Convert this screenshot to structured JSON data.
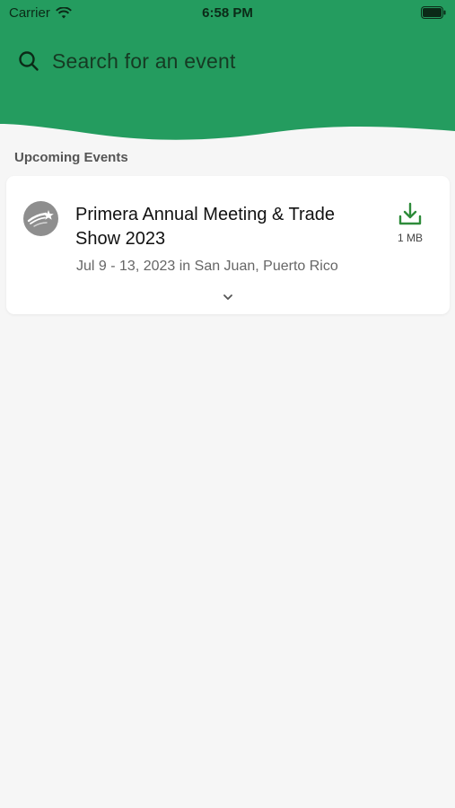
{
  "status_bar": {
    "carrier": "Carrier",
    "time": "6:58 PM"
  },
  "search": {
    "placeholder": "Search for an event"
  },
  "section": {
    "title": "Upcoming Events"
  },
  "events": [
    {
      "title": "Primera Annual Meeting & Trade Show 2023",
      "subtitle": "Jul 9 - 13, 2023 in San Juan, Puerto Rico",
      "download_size": "1 MB"
    }
  ],
  "colors": {
    "header_green": "#249c5f",
    "download_green": "#2e8b3a",
    "background": "#f6f6f6"
  }
}
